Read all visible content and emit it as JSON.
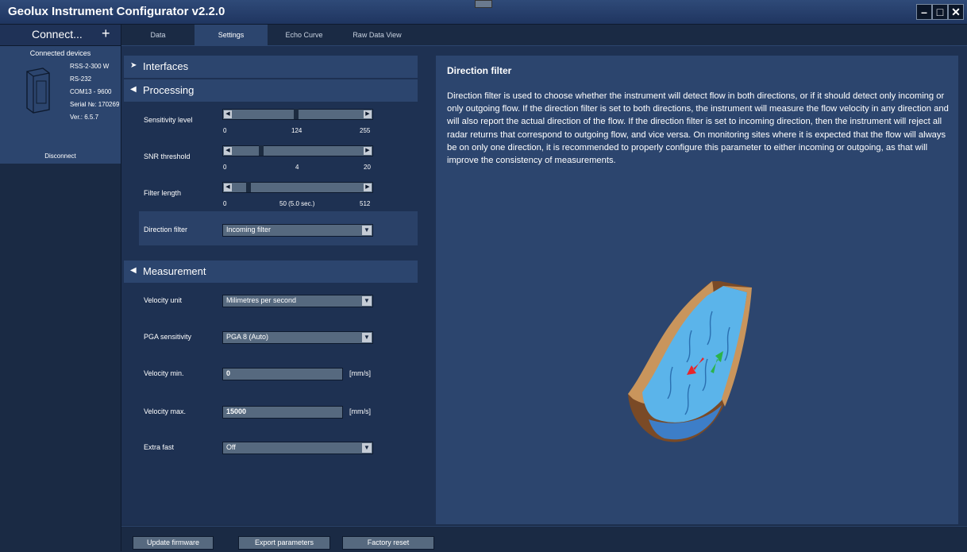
{
  "app": {
    "title": "Geolux Instrument Configurator v2.2.0"
  },
  "window_controls": {
    "minimize": "–",
    "maximize": "□",
    "close": "✕"
  },
  "sidebar": {
    "connect_label": "Connect...",
    "add_symbol": "+",
    "connected_devices_label": "Connected devices",
    "device": {
      "model": "RSS-2-300 W",
      "interface": "RS-232",
      "port": "COM13 - 9600",
      "serial": "Serial №: 170269",
      "version": "Ver.: 6.5.7",
      "disconnect_label": "Disconnect"
    }
  },
  "tabs": [
    {
      "label": "Data",
      "active": false
    },
    {
      "label": "Settings",
      "active": true
    },
    {
      "label": "Echo Curve",
      "active": false
    },
    {
      "label": "Raw Data View",
      "active": false
    }
  ],
  "sections": {
    "interfaces": {
      "title": "Interfaces",
      "expanded": false
    },
    "processing": {
      "title": "Processing",
      "expanded": true,
      "sensitivity": {
        "label": "Sensitivity level",
        "min": "0",
        "value": "124",
        "max": "255",
        "fraction": 0.486
      },
      "snr": {
        "label": "SNR threshold",
        "min": "0",
        "value": "4",
        "max": "20",
        "fraction": 0.2
      },
      "filter_length": {
        "label": "Filter length",
        "min": "0",
        "value": "50 (5.0 sec.)",
        "max": "512",
        "fraction": 0.098
      },
      "direction_filter": {
        "label": "Direction filter",
        "value": "Incoming filter"
      }
    },
    "measurement": {
      "title": "Measurement",
      "expanded": true,
      "velocity_unit": {
        "label": "Velocity unit",
        "value": "Milimetres per second"
      },
      "pga": {
        "label": "PGA sensitivity",
        "value": "PGA 8 (Auto)"
      },
      "velocity_min": {
        "label": "Velocity min.",
        "value": "0",
        "unit": "[mm/s]"
      },
      "velocity_max": {
        "label": "Velocity max.",
        "value": "15000",
        "unit": "[mm/s]"
      },
      "extra_fast": {
        "label": "Extra fast",
        "value": "Off"
      }
    }
  },
  "description": {
    "title": "Direction filter",
    "text": "Direction filter is used to choose whether the instrument will detect flow in both directions, or if it should detect only incoming or only outgoing flow. If the direction filter is set to both directions, the instrument will measure the flow velocity in any direction and will also report the actual direction of the flow. If the direction filter is set to incoming direction, then the instrument will reject all radar returns that correspond to outgoing flow, and vice versa. On monitoring sites where it is expected that the flow will always be on only one direction, it is recommended to properly configure this parameter to either incoming or outgoing, as that will improve the consistency of measurements."
  },
  "footer": {
    "update_firmware": "Update firmware",
    "export_parameters": "Export parameters",
    "factory_reset": "Factory reset"
  }
}
